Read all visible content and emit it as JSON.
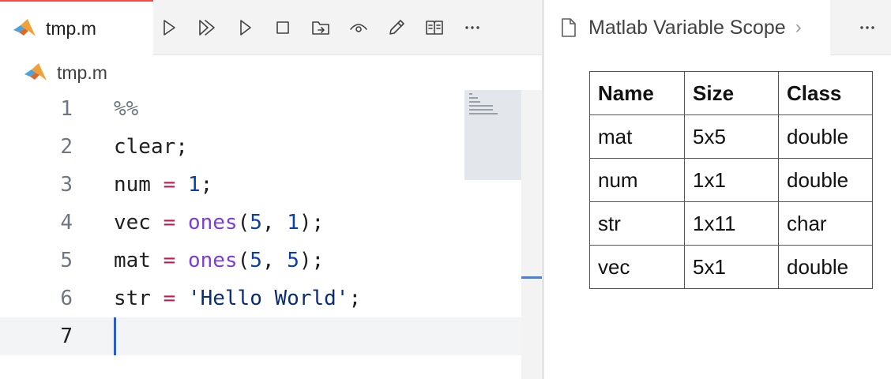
{
  "editor": {
    "tab": {
      "label": "tmp.m",
      "icon": "matlab-logo-icon"
    },
    "toolbar": [
      {
        "name": "run-icon",
        "tooltip": "Run"
      },
      {
        "name": "run-all-icon",
        "tooltip": "Run All"
      },
      {
        "name": "run-section-icon",
        "tooltip": "Run Section"
      },
      {
        "name": "stop-icon",
        "tooltip": "Stop"
      },
      {
        "name": "open-folder-icon",
        "tooltip": "Open Folder"
      },
      {
        "name": "eye-icon",
        "tooltip": "View"
      },
      {
        "name": "pencil-icon",
        "tooltip": "Edit"
      },
      {
        "name": "book-icon",
        "tooltip": "Documentation"
      },
      {
        "name": "more-icon",
        "tooltip": "More"
      }
    ],
    "breadcrumb": {
      "label": "tmp.m"
    },
    "lines": [
      {
        "n": "1",
        "text": "%%"
      },
      {
        "n": "2",
        "text": "clear;"
      },
      {
        "n": "3",
        "text": "num = 1;"
      },
      {
        "n": "4",
        "text": "vec = ones(5, 1);"
      },
      {
        "n": "5",
        "text": "mat = ones(5, 5);"
      },
      {
        "n": "6",
        "text": "str = 'Hello World';"
      },
      {
        "n": "7",
        "text": ""
      }
    ],
    "current_line": 7
  },
  "colors": {
    "operator": "#c41a4a",
    "number": "#0b3fa8",
    "function": "#7b3fd6",
    "string": "#0b2e72",
    "cursor": "#1e5fd6",
    "tab_accent": "#f14c4c"
  },
  "panel": {
    "title": "Matlab Variable Scope",
    "icon": "file-icon",
    "table": {
      "headers": [
        "Name",
        "Size",
        "Class"
      ],
      "rows": [
        [
          "mat",
          "5x5",
          "double"
        ],
        [
          "num",
          "1x1",
          "double"
        ],
        [
          "str",
          "1x11",
          "char"
        ],
        [
          "vec",
          "5x1",
          "double"
        ]
      ]
    }
  }
}
